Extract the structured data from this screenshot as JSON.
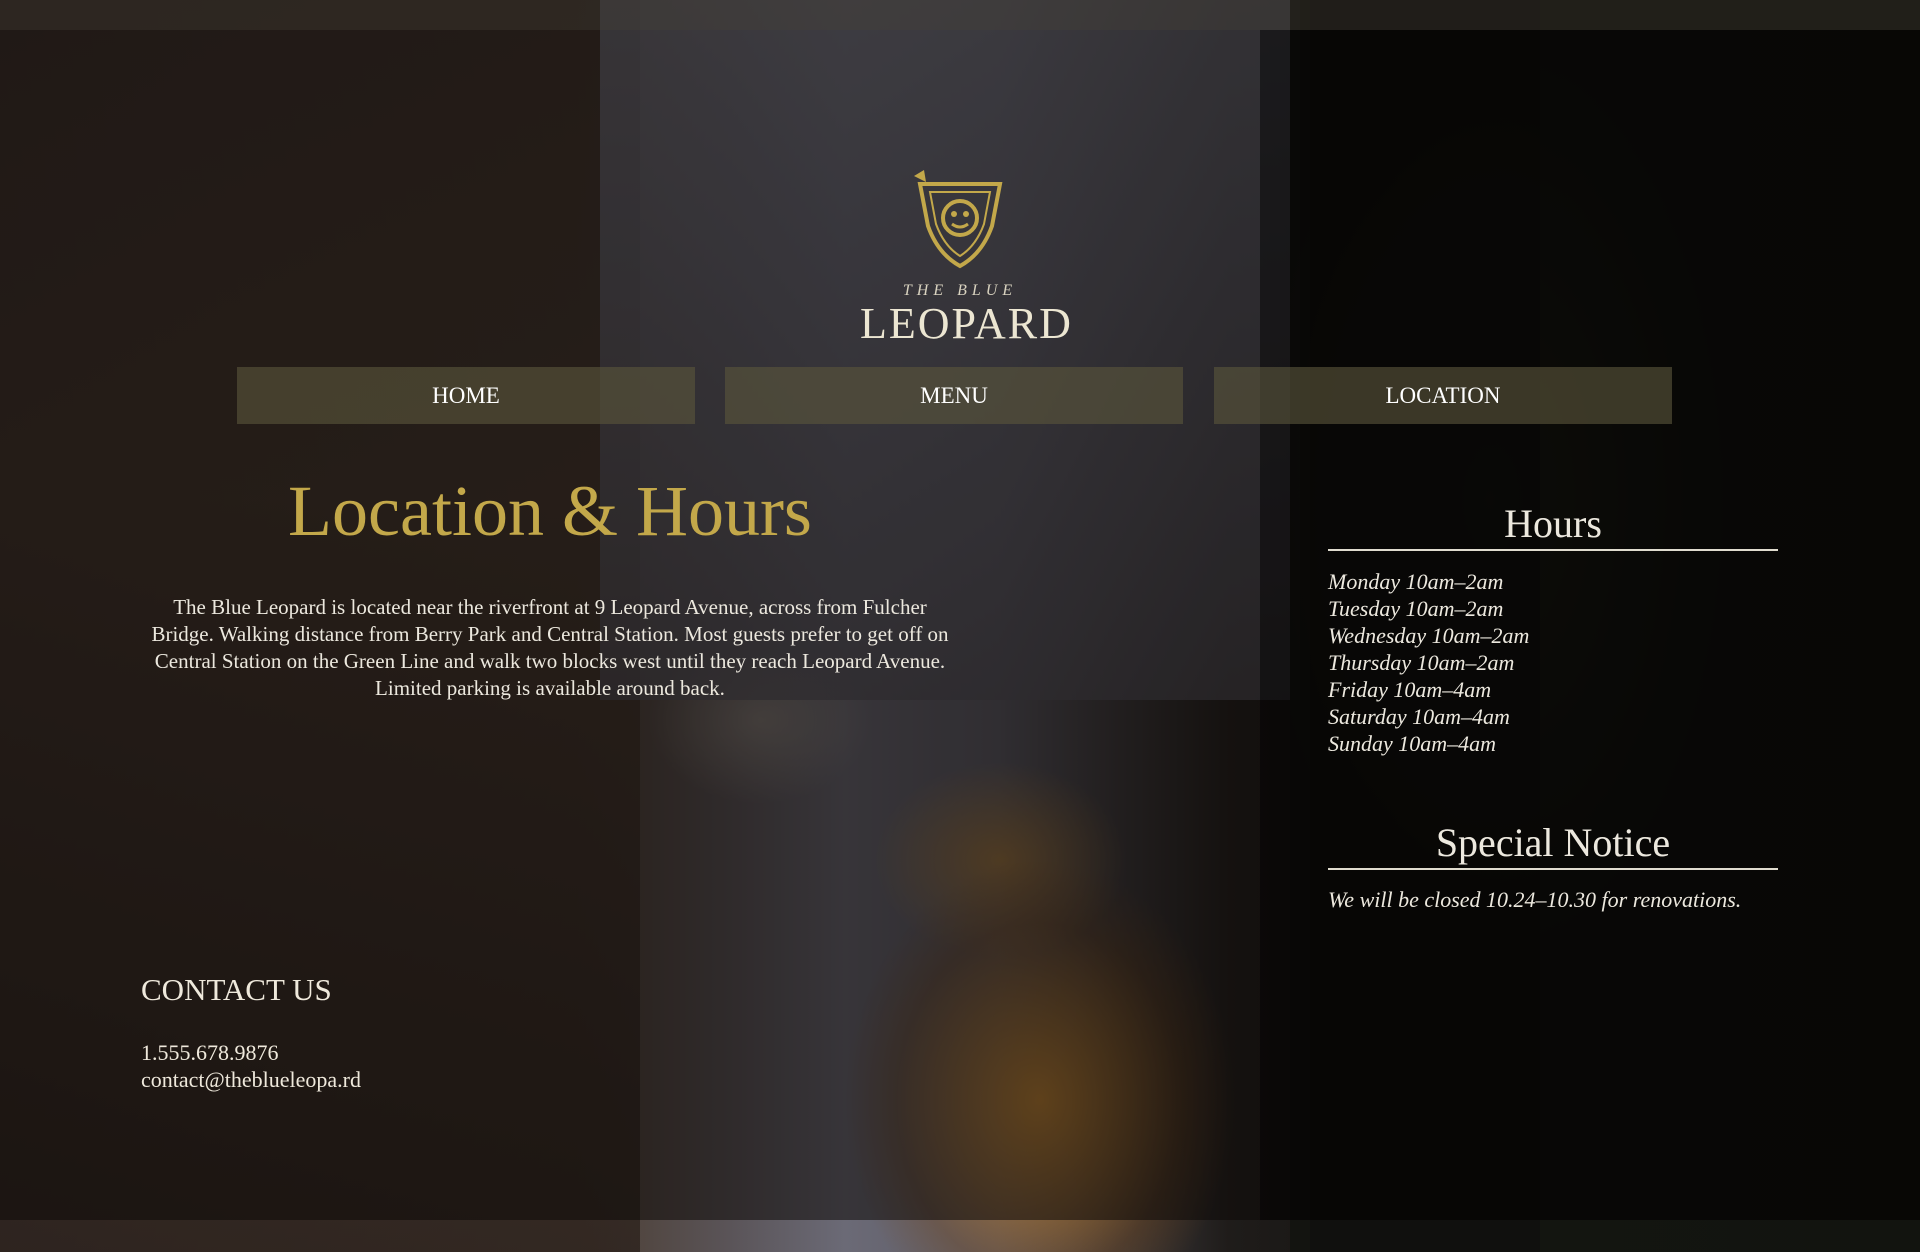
{
  "brand": {
    "logo_small": "THE BLUE",
    "logo_big": "LEOPARD",
    "accent_color": "#c3a84a"
  },
  "nav": {
    "home": "HOME",
    "menu": "MENU",
    "location": "LOCATION"
  },
  "main": {
    "title": "Location & Hours",
    "intro": "The Blue Leopard is located near the riverfront at 9 Leopard Avenue, across from Fulcher Bridge. Walking distance from Berry Park and Central Station. Most guests prefer to get off on Central Station on the Green Line and walk two blocks west until they reach Leopard Avenue. Limited parking is available around back."
  },
  "contact": {
    "heading": "CONTACT US",
    "phone": "1.555.678.9876",
    "email": "contact@theblueleopa.rd"
  },
  "hours": {
    "heading": "Hours",
    "days": [
      "Monday 10am–2am",
      "Tuesday 10am–2am",
      "Wednesday 10am–2am",
      "Thursday 10am–2am",
      "Friday 10am–4am",
      "Saturday 10am–4am",
      "Sunday 10am–4am"
    ]
  },
  "notice": {
    "heading": "Special Notice",
    "text": "We will be closed 10.24–10.30 for renovations."
  }
}
